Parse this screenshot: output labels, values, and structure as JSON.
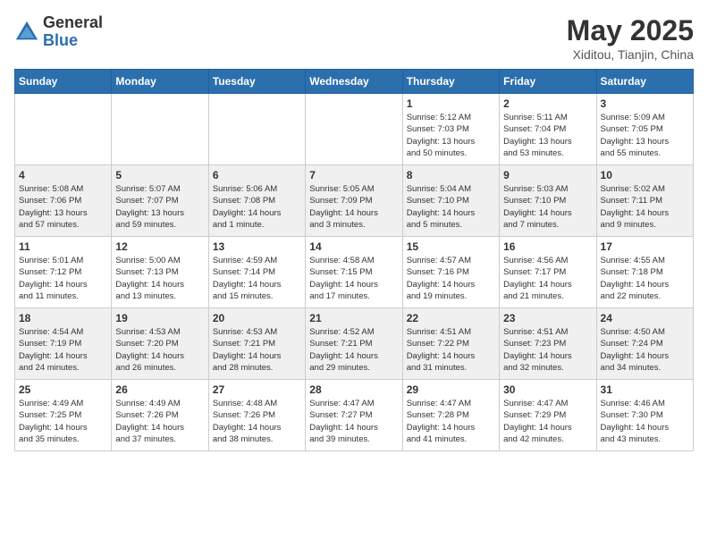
{
  "header": {
    "logo_general": "General",
    "logo_blue": "Blue",
    "month_title": "May 2025",
    "location": "Xiditou, Tianjin, China"
  },
  "weekdays": [
    "Sunday",
    "Monday",
    "Tuesday",
    "Wednesday",
    "Thursday",
    "Friday",
    "Saturday"
  ],
  "weeks": [
    [
      {
        "day": "",
        "info": ""
      },
      {
        "day": "",
        "info": ""
      },
      {
        "day": "",
        "info": ""
      },
      {
        "day": "",
        "info": ""
      },
      {
        "day": "1",
        "info": "Sunrise: 5:12 AM\nSunset: 7:03 PM\nDaylight: 13 hours\nand 50 minutes."
      },
      {
        "day": "2",
        "info": "Sunrise: 5:11 AM\nSunset: 7:04 PM\nDaylight: 13 hours\nand 53 minutes."
      },
      {
        "day": "3",
        "info": "Sunrise: 5:09 AM\nSunset: 7:05 PM\nDaylight: 13 hours\nand 55 minutes."
      }
    ],
    [
      {
        "day": "4",
        "info": "Sunrise: 5:08 AM\nSunset: 7:06 PM\nDaylight: 13 hours\nand 57 minutes."
      },
      {
        "day": "5",
        "info": "Sunrise: 5:07 AM\nSunset: 7:07 PM\nDaylight: 13 hours\nand 59 minutes."
      },
      {
        "day": "6",
        "info": "Sunrise: 5:06 AM\nSunset: 7:08 PM\nDaylight: 14 hours\nand 1 minute."
      },
      {
        "day": "7",
        "info": "Sunrise: 5:05 AM\nSunset: 7:09 PM\nDaylight: 14 hours\nand 3 minutes."
      },
      {
        "day": "8",
        "info": "Sunrise: 5:04 AM\nSunset: 7:10 PM\nDaylight: 14 hours\nand 5 minutes."
      },
      {
        "day": "9",
        "info": "Sunrise: 5:03 AM\nSunset: 7:10 PM\nDaylight: 14 hours\nand 7 minutes."
      },
      {
        "day": "10",
        "info": "Sunrise: 5:02 AM\nSunset: 7:11 PM\nDaylight: 14 hours\nand 9 minutes."
      }
    ],
    [
      {
        "day": "11",
        "info": "Sunrise: 5:01 AM\nSunset: 7:12 PM\nDaylight: 14 hours\nand 11 minutes."
      },
      {
        "day": "12",
        "info": "Sunrise: 5:00 AM\nSunset: 7:13 PM\nDaylight: 14 hours\nand 13 minutes."
      },
      {
        "day": "13",
        "info": "Sunrise: 4:59 AM\nSunset: 7:14 PM\nDaylight: 14 hours\nand 15 minutes."
      },
      {
        "day": "14",
        "info": "Sunrise: 4:58 AM\nSunset: 7:15 PM\nDaylight: 14 hours\nand 17 minutes."
      },
      {
        "day": "15",
        "info": "Sunrise: 4:57 AM\nSunset: 7:16 PM\nDaylight: 14 hours\nand 19 minutes."
      },
      {
        "day": "16",
        "info": "Sunrise: 4:56 AM\nSunset: 7:17 PM\nDaylight: 14 hours\nand 21 minutes."
      },
      {
        "day": "17",
        "info": "Sunrise: 4:55 AM\nSunset: 7:18 PM\nDaylight: 14 hours\nand 22 minutes."
      }
    ],
    [
      {
        "day": "18",
        "info": "Sunrise: 4:54 AM\nSunset: 7:19 PM\nDaylight: 14 hours\nand 24 minutes."
      },
      {
        "day": "19",
        "info": "Sunrise: 4:53 AM\nSunset: 7:20 PM\nDaylight: 14 hours\nand 26 minutes."
      },
      {
        "day": "20",
        "info": "Sunrise: 4:53 AM\nSunset: 7:21 PM\nDaylight: 14 hours\nand 28 minutes."
      },
      {
        "day": "21",
        "info": "Sunrise: 4:52 AM\nSunset: 7:21 PM\nDaylight: 14 hours\nand 29 minutes."
      },
      {
        "day": "22",
        "info": "Sunrise: 4:51 AM\nSunset: 7:22 PM\nDaylight: 14 hours\nand 31 minutes."
      },
      {
        "day": "23",
        "info": "Sunrise: 4:51 AM\nSunset: 7:23 PM\nDaylight: 14 hours\nand 32 minutes."
      },
      {
        "day": "24",
        "info": "Sunrise: 4:50 AM\nSunset: 7:24 PM\nDaylight: 14 hours\nand 34 minutes."
      }
    ],
    [
      {
        "day": "25",
        "info": "Sunrise: 4:49 AM\nSunset: 7:25 PM\nDaylight: 14 hours\nand 35 minutes."
      },
      {
        "day": "26",
        "info": "Sunrise: 4:49 AM\nSunset: 7:26 PM\nDaylight: 14 hours\nand 37 minutes."
      },
      {
        "day": "27",
        "info": "Sunrise: 4:48 AM\nSunset: 7:26 PM\nDaylight: 14 hours\nand 38 minutes."
      },
      {
        "day": "28",
        "info": "Sunrise: 4:47 AM\nSunset: 7:27 PM\nDaylight: 14 hours\nand 39 minutes."
      },
      {
        "day": "29",
        "info": "Sunrise: 4:47 AM\nSunset: 7:28 PM\nDaylight: 14 hours\nand 41 minutes."
      },
      {
        "day": "30",
        "info": "Sunrise: 4:47 AM\nSunset: 7:29 PM\nDaylight: 14 hours\nand 42 minutes."
      },
      {
        "day": "31",
        "info": "Sunrise: 4:46 AM\nSunset: 7:30 PM\nDaylight: 14 hours\nand 43 minutes."
      }
    ]
  ]
}
